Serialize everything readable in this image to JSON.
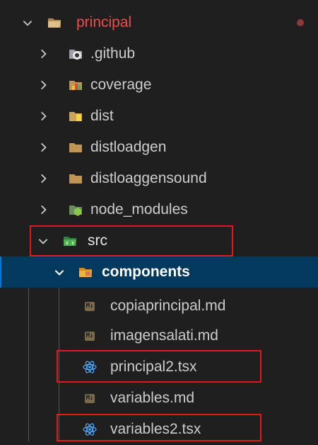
{
  "explorer": {
    "root": {
      "label": "principal",
      "expanded": true,
      "icon": "folder-open-icon"
    },
    "items": [
      {
        "label": ".github",
        "icon": "github-folder-icon",
        "expanded": false
      },
      {
        "label": "coverage",
        "icon": "coverage-folder-icon",
        "expanded": false
      },
      {
        "label": "dist",
        "icon": "dist-folder-icon",
        "expanded": false
      },
      {
        "label": "distloadgen",
        "icon": "folder-icon",
        "expanded": false
      },
      {
        "label": "distloaggensound",
        "icon": "folder-icon",
        "expanded": false
      },
      {
        "label": "node_modules",
        "icon": "node-folder-icon",
        "expanded": false
      },
      {
        "label": "src",
        "icon": "src-folder-icon",
        "expanded": true
      },
      {
        "label": "components",
        "icon": "components-folder-icon",
        "expanded": true,
        "selected": true
      },
      {
        "label": "copiaprincipal.md",
        "icon": "markdown-file-icon"
      },
      {
        "label": "imagensalati.md",
        "icon": "markdown-file-icon"
      },
      {
        "label": "principal2.tsx",
        "icon": "react-file-icon"
      },
      {
        "label": "variables.md",
        "icon": "markdown-file-icon"
      },
      {
        "label": "variables2.tsx",
        "icon": "react-file-icon"
      }
    ],
    "md_badge": "M↓"
  },
  "colors": {
    "background": "#1f1f1f",
    "selection": "#04395e",
    "error_text": "#f14c4c",
    "highlight_box": "#e01b1b",
    "react_icon": "#4fa8ff",
    "folder": "#c09553"
  }
}
